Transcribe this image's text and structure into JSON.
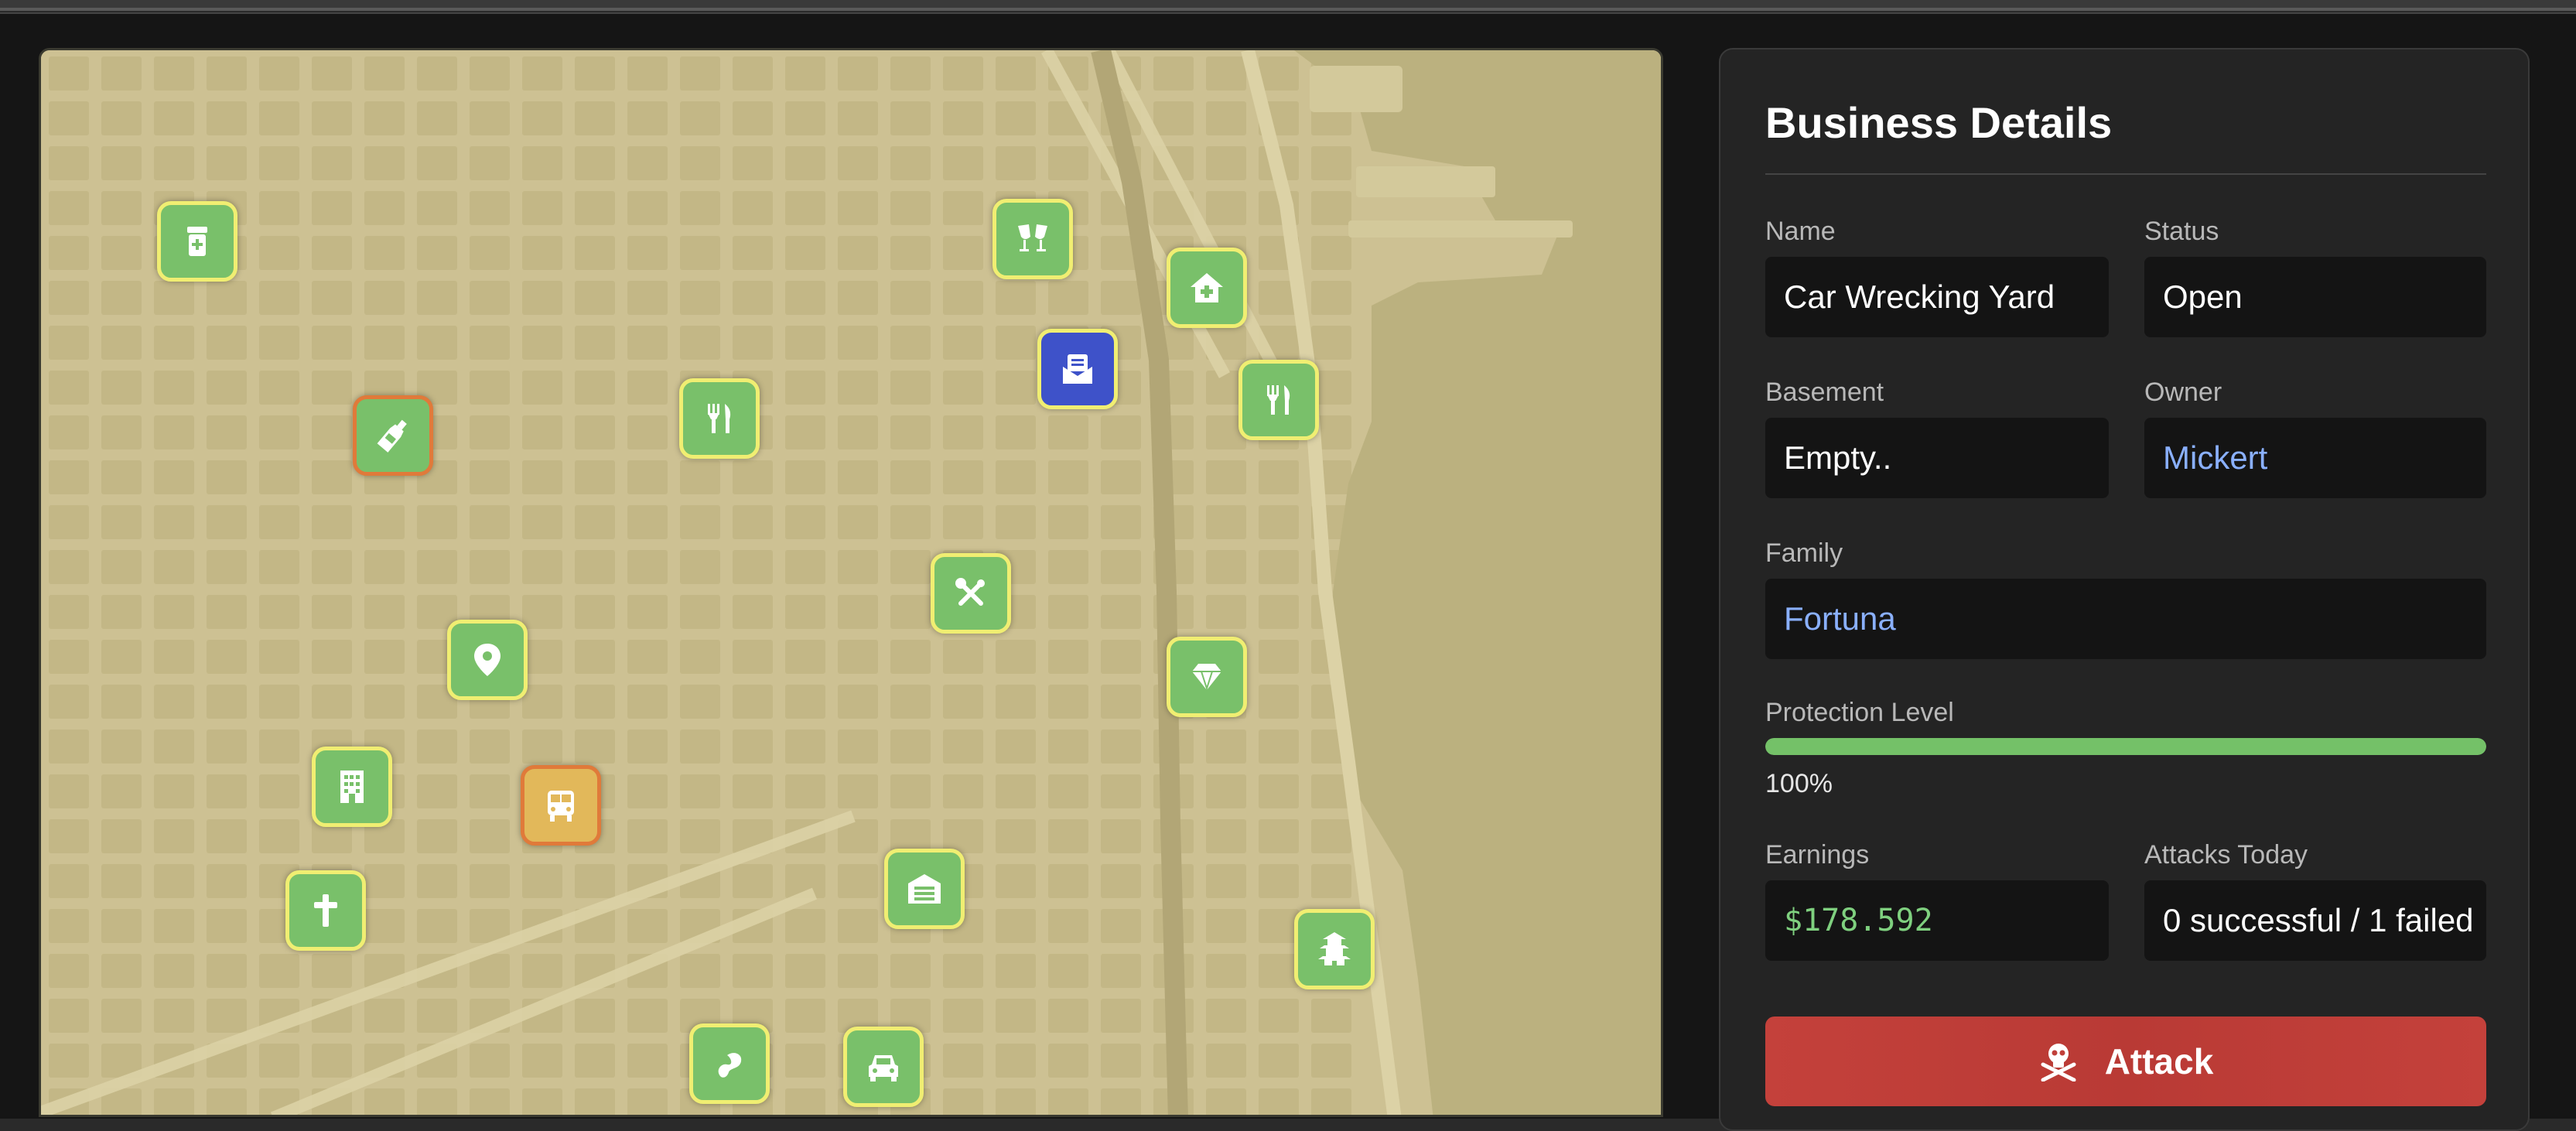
{
  "panel": {
    "title": "Business Details",
    "name_label": "Name",
    "name_value": "Car Wrecking Yard",
    "status_label": "Status",
    "status_value": "Open",
    "basement_label": "Basement",
    "basement_value": "Empty..",
    "owner_label": "Owner",
    "owner_value": "Mickert",
    "family_label": "Family",
    "family_value": "Fortuna",
    "protection_label": "Protection Level",
    "protection_value": "100%",
    "protection_fraction": 1.0,
    "earnings_label": "Earnings",
    "earnings_value": "$178.592",
    "attacks_label": "Attacks Today",
    "attacks_value": "0 successful / 1 failed",
    "attack_button": "Attack",
    "attack_icon": "skull-crossbones-icon"
  },
  "map": {
    "markers": [
      {
        "icon": "pharmacy-icon",
        "style": "green"
      },
      {
        "icon": "cheers-icon",
        "style": "green"
      },
      {
        "icon": "hospital-icon",
        "style": "green"
      },
      {
        "icon": "mailbox-icon",
        "style": "blue"
      },
      {
        "icon": "restaurant-icon",
        "style": "green"
      },
      {
        "icon": "restaurant-icon",
        "style": "green"
      },
      {
        "icon": "bottle-icon",
        "style": "orange-border"
      },
      {
        "icon": "tools-icon",
        "style": "green"
      },
      {
        "icon": "location-pin-icon",
        "style": "green"
      },
      {
        "icon": "diamond-icon",
        "style": "green"
      },
      {
        "icon": "building-icon",
        "style": "green"
      },
      {
        "icon": "bus-icon",
        "style": "amber"
      },
      {
        "icon": "church-cross-icon",
        "style": "green"
      },
      {
        "icon": "warehouse-icon",
        "style": "green"
      },
      {
        "icon": "pagoda-icon",
        "style": "green"
      },
      {
        "icon": "horse-track-icon",
        "style": "green"
      },
      {
        "icon": "car-icon",
        "style": "green"
      }
    ],
    "colors": {
      "marker_fill": "#79c06a",
      "marker_border": "#f0ee72",
      "selected_border": "#e07a3a",
      "water": "#bab07e",
      "land": "#cfc394"
    }
  }
}
